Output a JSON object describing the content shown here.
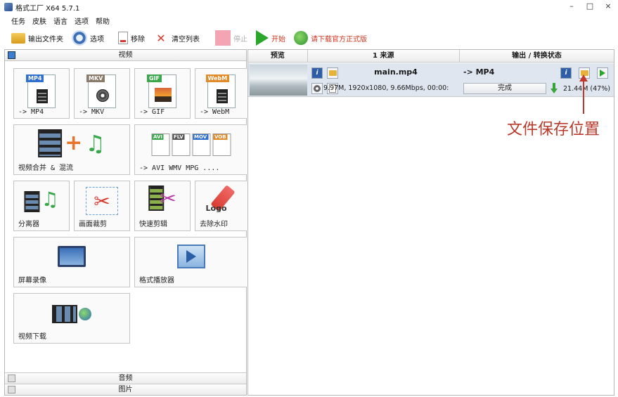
{
  "window": {
    "title": "格式工厂 X64 5.7.1",
    "controls": [
      "–",
      "□",
      "×"
    ]
  },
  "menu": [
    "任务",
    "皮肤",
    "语言",
    "选项",
    "帮助"
  ],
  "toolbar": {
    "output_folder": "输出文件夹",
    "options": "选项",
    "remove": "移除",
    "clear_list": "清空列表",
    "stop": "停止",
    "start": "开始",
    "download_official": "请下载官方正式版"
  },
  "left_panel": {
    "video_category": "视频",
    "tiles": {
      "mp4": {
        "badge": "MP4",
        "label": "-> MP4"
      },
      "mkv": {
        "badge": "MKV",
        "label": "-> MKV"
      },
      "gif": {
        "badge": "GIF",
        "label": "-> GIF"
      },
      "webm": {
        "badge": "WebM",
        "label": "-> WebM"
      },
      "merge": {
        "label": "视频合并 & 混流"
      },
      "multi": {
        "label": "-> AVI WMV MPG ....",
        "badges": [
          "AVI",
          "FLV",
          "MOV",
          "VOB"
        ]
      },
      "splitter": {
        "label": "分离器"
      },
      "crop": {
        "label": "画面裁剪"
      },
      "quick_cut": {
        "label": "快速剪辑"
      },
      "watermark": {
        "label": "去除水印",
        "logo_text": "Logo"
      },
      "screen_record": {
        "label": "屏幕录像"
      },
      "player": {
        "label": "格式播放器"
      },
      "download": {
        "label": "视频下载"
      }
    },
    "audio_category": "音频",
    "picture_category": "图片"
  },
  "right_panel": {
    "headers": {
      "preview": "预览",
      "source": "1 来源",
      "output": "输出 / 转换状态"
    },
    "task": {
      "source_name": "main.mp4",
      "source_info": "9.97M, 1920x1080, 9.66Mbps, 00:00:",
      "output_format": "-> MP4",
      "status": "完成",
      "progress": "21.44M (47%)"
    }
  },
  "annotation": {
    "text": "文件保存位置",
    "color": "#c0392b"
  }
}
